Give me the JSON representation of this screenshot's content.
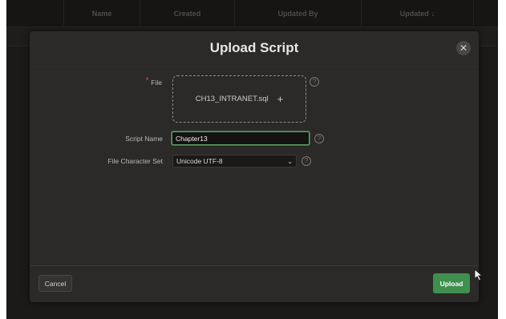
{
  "report": {
    "columns": [
      "Name",
      "Created",
      "Updated By",
      "Updated"
    ],
    "sort_icon": "sort-descending-icon"
  },
  "dialog": {
    "title": "Upload Script",
    "close_icon": "close-icon",
    "file_label": "File",
    "file_required_marker": "*",
    "file_value": "CH13_INTRANET.sql",
    "file_add_symbol": "+",
    "script_name_label": "Script Name",
    "script_name_value": "Chapter13",
    "charset_label": "File Character Set",
    "charset_value": "Unicode UTF-8",
    "help_symbol": "?",
    "cancel_label": "Cancel",
    "upload_label": "Upload"
  },
  "colors": {
    "accent": "#3f8f4f",
    "dialog_bg": "#2b2a28",
    "required": "#e25b5b"
  }
}
